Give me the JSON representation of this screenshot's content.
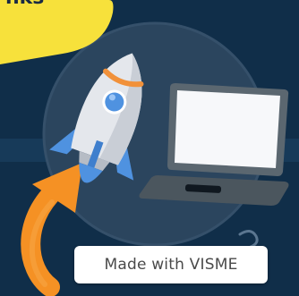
{
  "banner": {
    "partial_text": "nks"
  },
  "watermark": {
    "label": "Made with VISME"
  },
  "icons": {
    "rocket": "rocket-icon",
    "laptop": "laptop-icon",
    "arrow": "curved-arrow-icon"
  },
  "colors": {
    "background": "#102e49",
    "banner": "#f7e13b",
    "circle": "#2b455e",
    "rocket_body": "#e4e7ec",
    "rocket_stripe": "#f1913a",
    "rocket_fins": "#4f92e0",
    "laptop_body": "#5b6770",
    "laptop_screen": "#f7f8fa",
    "arrow": "#f59124",
    "badge_text": "#4a4a4a"
  }
}
